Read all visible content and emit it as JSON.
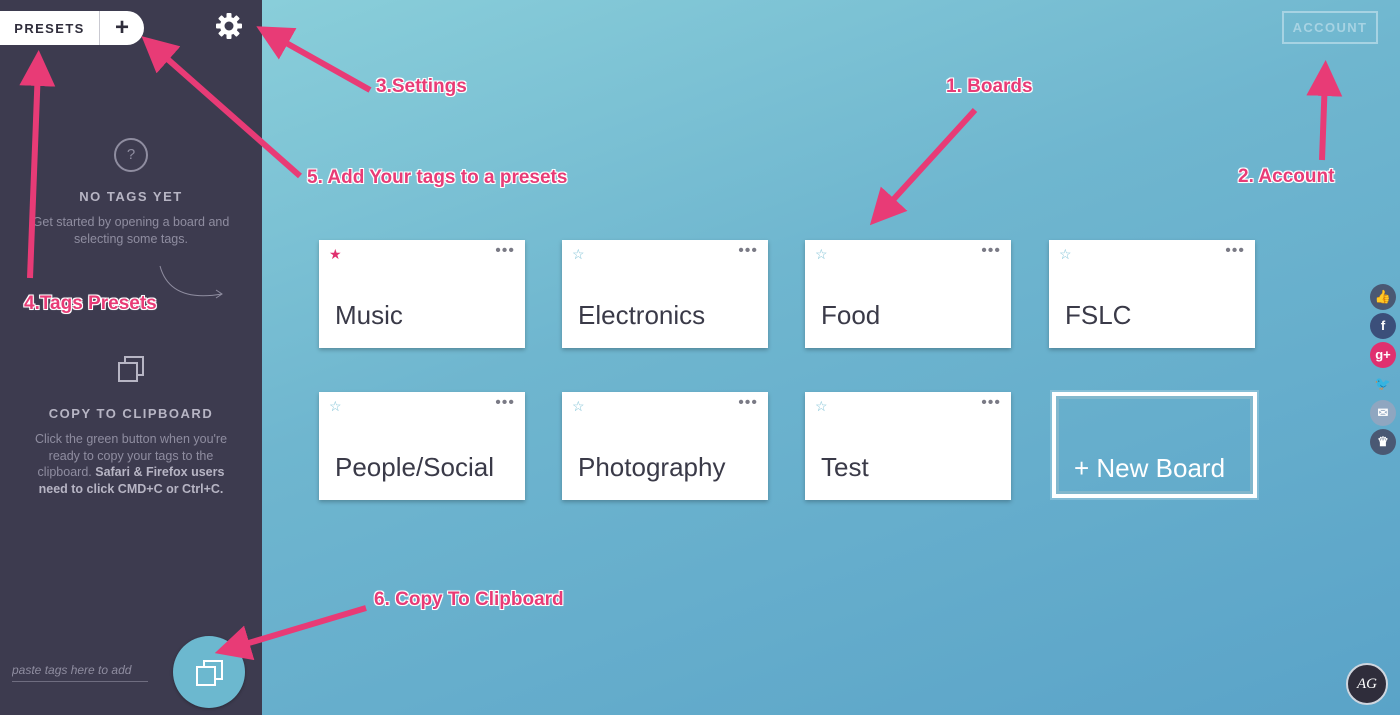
{
  "sidebar": {
    "presets_label": "PRESETS",
    "add_label": "+",
    "empty": {
      "icon": "?",
      "title": "NO TAGS YET",
      "description": "Get started by opening a board and selecting some tags."
    },
    "copy": {
      "title": "COPY TO CLIPBOARD",
      "description": "Click the green button when you're ready to copy your tags to the clipboard.",
      "description_bold": "Safari & Firefox users need to click CMD+C or Ctrl+C."
    },
    "paste_placeholder": "paste tags here to add"
  },
  "header": {
    "account_label": "ACCOUNT"
  },
  "boards": [
    {
      "name": "Music",
      "starred": true
    },
    {
      "name": "Electronics",
      "starred": false
    },
    {
      "name": "Food",
      "starred": false
    },
    {
      "name": "FSLC",
      "starred": false
    },
    {
      "name": "People/Social",
      "starred": false
    },
    {
      "name": "Photography",
      "starred": false
    },
    {
      "name": "Test",
      "starred": false
    }
  ],
  "new_board_label": "+ New Board",
  "social": [
    "like",
    "f",
    "g+",
    "twitter",
    "mail",
    "crown"
  ],
  "avatar_initials": "AG",
  "annotations": {
    "boards": "1. Boards",
    "account": "2. Account",
    "settings": "3.Settings",
    "tags_presets": "4.Tags Presets",
    "add_tags": "5. Add Your tags to a presets",
    "copy": "6. Copy To Clipboard"
  },
  "colors": {
    "accent": "#e83b76",
    "sidebar": "#3d3b4f",
    "star_on": "#e0306f"
  }
}
